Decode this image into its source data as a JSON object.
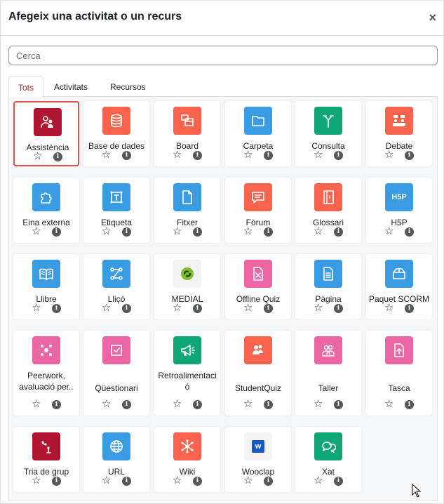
{
  "modal": {
    "title": "Afegeix una activitat o un recurs",
    "close_symbol": "×"
  },
  "search": {
    "placeholder": "Cerca",
    "value": ""
  },
  "tabs": [
    {
      "label": "Tots",
      "active": true
    },
    {
      "label": "Activitats",
      "active": false
    },
    {
      "label": "Recursos",
      "active": false
    }
  ],
  "colors": {
    "admin": "#b01531",
    "red": "#f7634d",
    "blue": "#399be2",
    "green": "#11a676",
    "pink": "#eb66a2",
    "neutral": "#f3f3f3"
  },
  "activities": [
    {
      "name": "Assistència",
      "color": "#b01531",
      "icon": "attendance-icon",
      "selected": true
    },
    {
      "name": "Base de dades",
      "color": "#f7634d",
      "icon": "database-icon"
    },
    {
      "name": "Board",
      "color": "#f7634d",
      "icon": "board-icon"
    },
    {
      "name": "Carpeta",
      "color": "#399be2",
      "icon": "folder-icon"
    },
    {
      "name": "Consulta",
      "color": "#11a676",
      "icon": "choice-icon"
    },
    {
      "name": "Debate",
      "color": "#f7634d",
      "icon": "debate-icon"
    },
    {
      "name": "Eina externa",
      "color": "#399be2",
      "icon": "puzzle-icon"
    },
    {
      "name": "Etiqueta",
      "color": "#399be2",
      "icon": "label-icon"
    },
    {
      "name": "Fitxer",
      "color": "#399be2",
      "icon": "file-icon"
    },
    {
      "name": "Fòrum",
      "color": "#f7634d",
      "icon": "forum-icon"
    },
    {
      "name": "Glossari",
      "color": "#f7634d",
      "icon": "glossary-icon"
    },
    {
      "name": "H5P",
      "color": "#399be2",
      "icon": "h5p-icon",
      "glyph": "H5P"
    },
    {
      "name": "Llibre",
      "color": "#399be2",
      "icon": "book-icon"
    },
    {
      "name": "Lliçó",
      "color": "#399be2",
      "icon": "lesson-icon"
    },
    {
      "name": "MEDIAL",
      "color": "#f3f3f3",
      "icon": "medial-logo-icon"
    },
    {
      "name": "Offline Quiz",
      "color": "#eb66a2",
      "icon": "offline-quiz-icon"
    },
    {
      "name": "Pàgina",
      "color": "#399be2",
      "icon": "page-icon"
    },
    {
      "name": "Paquet SCORM",
      "color": "#399be2",
      "icon": "scorm-package-icon"
    },
    {
      "name": "Peerwork, avaluació per..",
      "color": "#eb66a2",
      "icon": "peerwork-icon"
    },
    {
      "name": "Qüestionari",
      "color": "#eb66a2",
      "icon": "quiz-icon"
    },
    {
      "name": "Retroalimentació",
      "color": "#11a676",
      "icon": "feedback-icon"
    },
    {
      "name": "StudentQuiz",
      "color": "#f7634d",
      "icon": "studentquiz-icon"
    },
    {
      "name": "Taller",
      "color": "#eb66a2",
      "icon": "workshop-icon"
    },
    {
      "name": "Tasca",
      "color": "#eb66a2",
      "icon": "assignment-icon"
    },
    {
      "name": "Tria de grup",
      "color": "#b01531",
      "icon": "group-choice-icon"
    },
    {
      "name": "URL",
      "color": "#399be2",
      "icon": "url-globe-icon"
    },
    {
      "name": "Wiki",
      "color": "#f7634d",
      "icon": "wiki-icon"
    },
    {
      "name": "Wooclap",
      "color": "#f3f3f3",
      "icon": "wooclap-logo-icon",
      "glyph": "w"
    },
    {
      "name": "Xat",
      "color": "#11a676",
      "icon": "chat-icon"
    }
  ],
  "card_actions": {
    "star_symbol": "☆",
    "info_symbol": "i"
  }
}
